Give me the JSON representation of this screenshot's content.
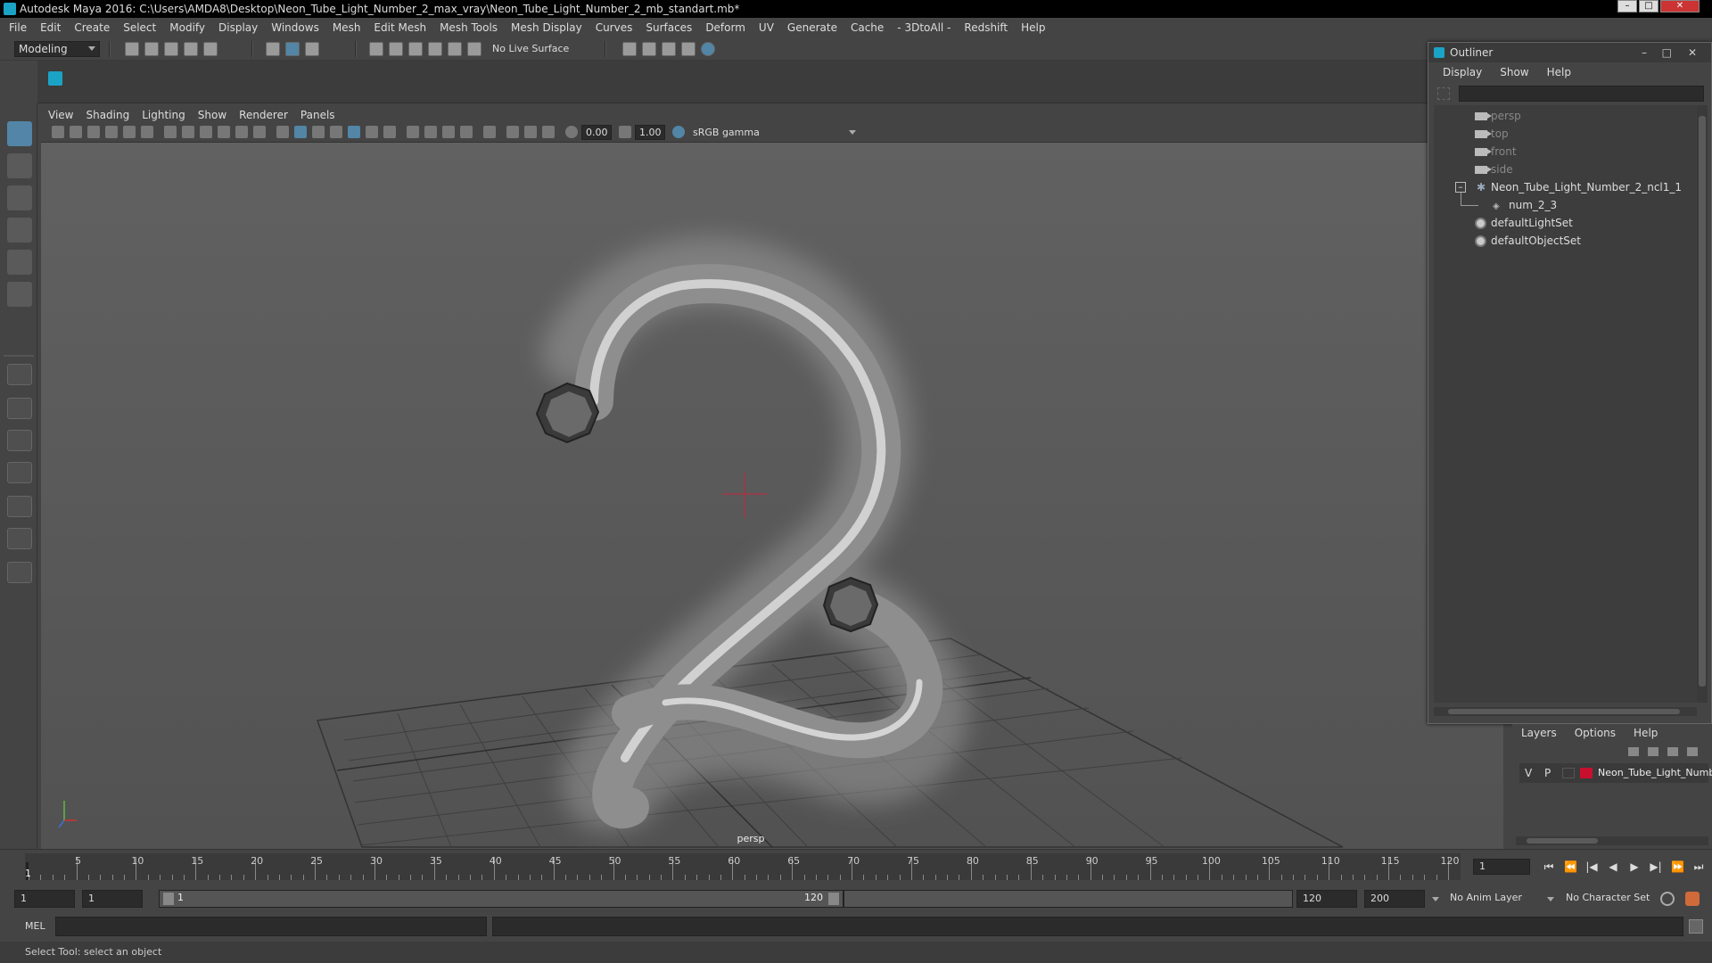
{
  "window": {
    "title": "Autodesk Maya 2016: C:\\Users\\AMDA8\\Desktop\\Neon_Tube_Light_Number_2_max_vray\\Neon_Tube_Light_Number_2_mb_standart.mb*"
  },
  "menus": [
    "File",
    "Edit",
    "Create",
    "Select",
    "Modify",
    "Display",
    "Windows",
    "Mesh",
    "Edit Mesh",
    "Mesh Tools",
    "Mesh Display",
    "Curves",
    "Surfaces",
    "Deform",
    "UV",
    "Generate",
    "Cache",
    "- 3DtoAll -",
    "Redshift",
    "Help"
  ],
  "status_line": {
    "mode": "Modeling",
    "live_surface": "No Live Surface"
  },
  "panel": {
    "menus": [
      "View",
      "Shading",
      "Lighting",
      "Show",
      "Renderer",
      "Panels"
    ],
    "near_value": "0.00",
    "far_value": "1.00",
    "color_space": "sRGB gamma",
    "camera_label": "persp"
  },
  "outliner": {
    "title": "Outliner",
    "menus": [
      "Display",
      "Show",
      "Help"
    ],
    "items": [
      {
        "label": "persp",
        "icon": "camera-icon",
        "dim": true
      },
      {
        "label": "top",
        "icon": "camera-icon",
        "dim": true
      },
      {
        "label": "front",
        "icon": "camera-icon",
        "dim": true
      },
      {
        "label": "side",
        "icon": "camera-icon",
        "dim": true
      },
      {
        "label": "Neon_Tube_Light_Number_2_ncl1_1",
        "icon": "transform-icon",
        "dim": false
      },
      {
        "label": "num_2_3",
        "icon": "mesh-icon",
        "dim": false
      },
      {
        "label": "defaultLightSet",
        "icon": "set-icon",
        "dim": false
      },
      {
        "label": "defaultObjectSet",
        "icon": "set-icon",
        "dim": false
      }
    ]
  },
  "layers": {
    "menus": [
      "Layers",
      "Options",
      "Help"
    ],
    "row": {
      "v": "V",
      "p": "P",
      "name": "Neon_Tube_Light_Numb",
      "color": "#c8102e"
    }
  },
  "timeline": {
    "ticks": [
      "5",
      "10",
      "15",
      "20",
      "25",
      "30",
      "35",
      "40",
      "45",
      "50",
      "55",
      "60",
      "65",
      "70",
      "75",
      "80",
      "85",
      "90",
      "95",
      "100",
      "105",
      "110",
      "115",
      "120"
    ],
    "current_frame": "1",
    "current_frame_field": "1"
  },
  "range": {
    "start": "1",
    "playback_start": "1",
    "slider_start": "1",
    "slider_end": "120",
    "playback_end": "120",
    "end": "200",
    "anim_layer": "No Anim Layer",
    "character_set": "No Character Set"
  },
  "command_line": {
    "language": "MEL"
  },
  "status_bar": {
    "message": "Select Tool: select an object"
  }
}
